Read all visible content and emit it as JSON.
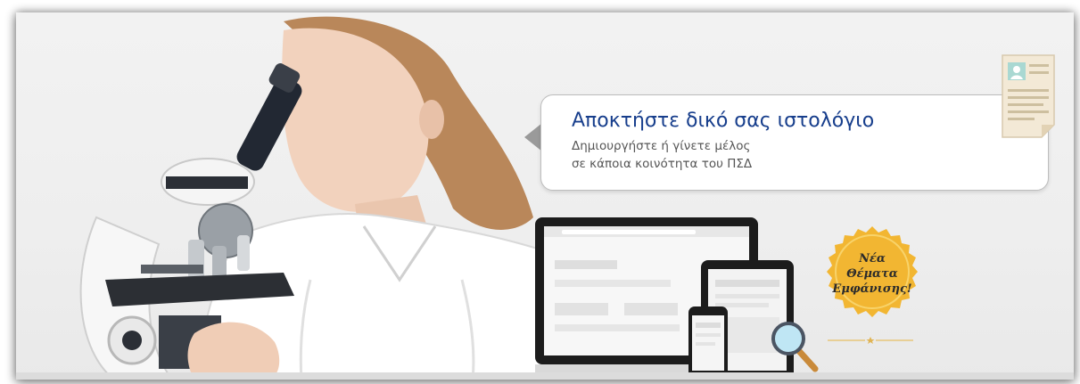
{
  "bubble": {
    "title": "Αποκτήστε δικό σας ιστολόγιο",
    "subtitle_line1": "Δημιουργήστε ή γίνετε μέλος",
    "subtitle_line2": "σε κάποια κοινότητα του ΠΣΔ"
  },
  "badge": {
    "line1": "Νέα",
    "line2": "Θέματα",
    "line3": "Εμφάνισης!"
  },
  "colors": {
    "title_blue": "#173e8c",
    "badge_gold": "#f2b632",
    "subtitle_gray": "#555555"
  },
  "icons": [
    "microscope-icon",
    "document-icon",
    "laptop-icon",
    "tablet-icon",
    "phone-icon",
    "magnifier-icon",
    "badge-seal-icon"
  ]
}
